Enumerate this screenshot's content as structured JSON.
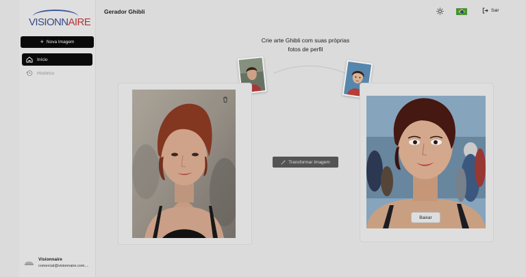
{
  "sidebar": {
    "logo_text_main": "VISIONN",
    "logo_text_accent": "AIRE",
    "new_button_label": "Nova Imagem",
    "nav": [
      {
        "label": "Início",
        "icon": "home-icon",
        "active": true
      },
      {
        "label": "Histórico",
        "icon": "history-icon",
        "active": false
      }
    ],
    "user": {
      "name": "Visionnaire",
      "email": "comercial@visionnaire.com...."
    }
  },
  "header": {
    "title": "Gerador Ghibli",
    "theme_icon": "sun-icon",
    "language_icon": "brazil-flag-icon",
    "logout_label": "Sair"
  },
  "main": {
    "headline_line1": "Crie arte Ghibli com suas próprias",
    "headline_line2": "fotos de perfil",
    "transform_button_label": "Transformar Imagem",
    "download_button_label": "Baixar"
  },
  "colors": {
    "primary": "#0b0b0b",
    "logo_blue": "#3b4f8f",
    "logo_red": "#c0393b",
    "transform_button": "#5a5a5a"
  }
}
